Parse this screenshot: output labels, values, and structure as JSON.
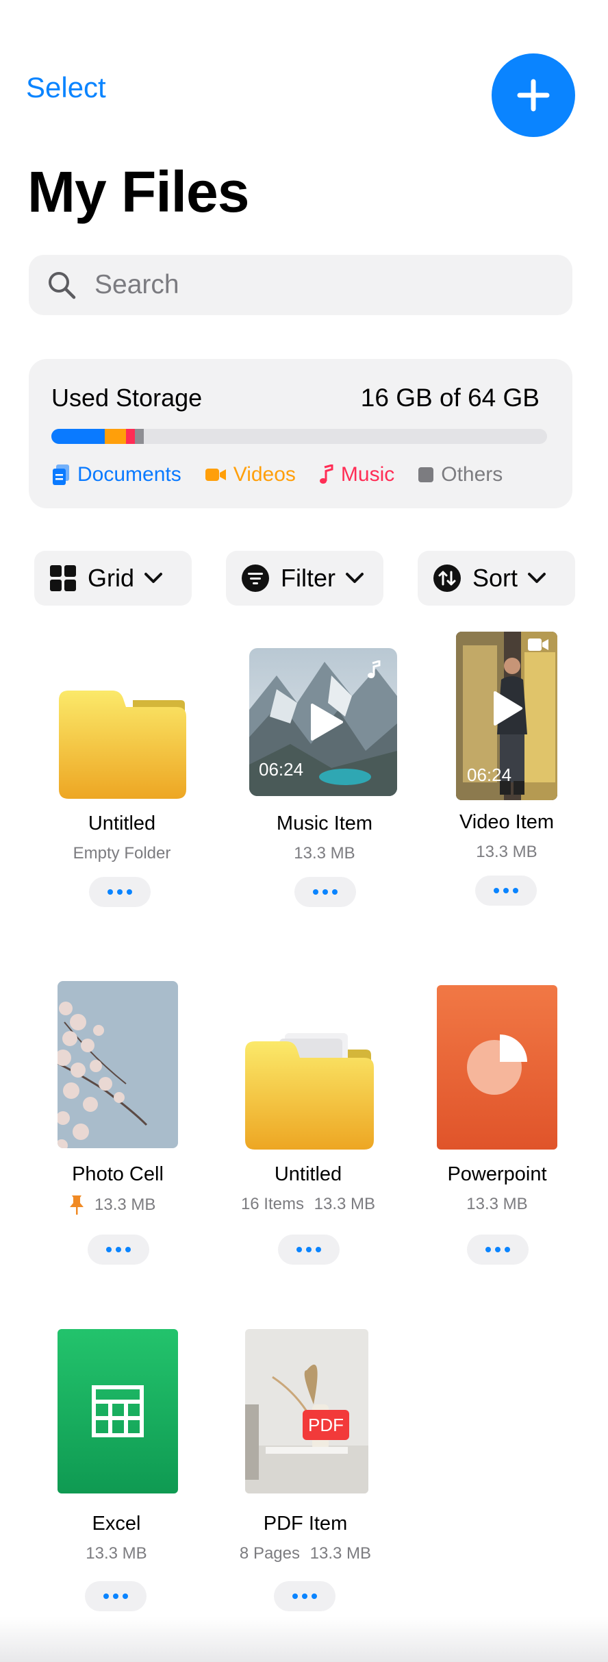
{
  "header": {
    "select_label": "Select",
    "title": "My Files"
  },
  "search": {
    "placeholder": "Search"
  },
  "storage": {
    "title": "Used Storage",
    "amount": "16 GB of 64 GB",
    "used_fraction": 0.25,
    "segments": [
      {
        "name": "Documents",
        "fraction": 0.108,
        "color": "#0a7aff"
      },
      {
        "name": "Videos",
        "fraction": 0.042,
        "color": "#ff9f0a"
      },
      {
        "name": "Music",
        "fraction": 0.019,
        "color": "#ff2d55"
      },
      {
        "name": "Others",
        "fraction": 0.017,
        "color": "#8e8e93"
      }
    ],
    "legend": {
      "documents": "Documents",
      "videos": "Videos",
      "music": "Music",
      "others": "Others"
    }
  },
  "controls": {
    "grid": "Grid",
    "filter": "Filter",
    "sort": "Sort"
  },
  "items": [
    {
      "name": "Untitled",
      "sub": "Empty Folder",
      "kind": "folder-icon"
    },
    {
      "name": "Music Item",
      "sub": "13.3 MB",
      "duration": "06:24",
      "kind": "music-thumbnail"
    },
    {
      "name": "Video Item",
      "sub": "13.3 MB",
      "duration": "06:24",
      "kind": "video-thumbnail"
    },
    {
      "name": "Photo Cell",
      "size": "13.3 MB",
      "pinned": true,
      "kind": "photo-thumbnail"
    },
    {
      "name": "Untitled",
      "count": "16 Items",
      "size": "13.3 MB",
      "kind": "folder-icon"
    },
    {
      "name": "Powerpoint",
      "sub": "13.3 MB",
      "kind": "powerpoint-icon"
    },
    {
      "name": "Excel",
      "sub": "13.3 MB",
      "kind": "excel-icon"
    },
    {
      "name": "PDF Item",
      "pages": "8 Pages",
      "size": "13.3 MB",
      "badge": "PDF",
      "kind": "pdf-thumbnail"
    }
  ],
  "colors": {
    "accent": "#0a84ff",
    "card_bg": "#f2f2f3",
    "secondary_text": "#7c7c80"
  }
}
